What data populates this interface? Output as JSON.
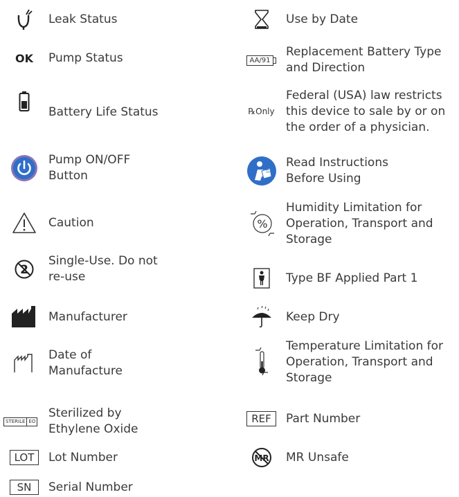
{
  "colors": {
    "accent_blue": "#2f6fc7",
    "power_ring": "#8a73b8",
    "text": "#3a3a3a"
  },
  "left": [
    {
      "icon": "leak-icon",
      "label": "Leak Status"
    },
    {
      "icon": "ok-text-icon",
      "icon_text": "OK",
      "label": "Pump Status"
    },
    {
      "icon": "battery-icon",
      "label": "Battery Life Status"
    },
    {
      "icon": "power-icon",
      "label": "Pump ON/OFF\nButton"
    },
    {
      "icon": "caution-icon",
      "label": "Caution"
    },
    {
      "icon": "single-use-icon",
      "label": "Single-Use. Do not\nre-use"
    },
    {
      "icon": "manufacturer-icon",
      "label": "Manufacturer"
    },
    {
      "icon": "date-of-manufacture-icon",
      "label": "Date of\nManufacture"
    },
    {
      "icon": "sterile-eo-icon",
      "icon_text_a": "STERILE",
      "icon_text_b": "EO",
      "label": "Sterilized by\nEthylene Oxide"
    },
    {
      "icon": "lot-icon",
      "icon_text": "LOT",
      "label": "Lot Number"
    },
    {
      "icon": "sn-icon",
      "icon_text": "SN",
      "label": "Serial Number"
    }
  ],
  "right": [
    {
      "icon": "hourglass-icon",
      "label": "Use by Date"
    },
    {
      "icon": "battery-type-icon",
      "icon_text": "AA/91",
      "label": "Replacement Battery Type\nand Direction"
    },
    {
      "icon": "rx-only-icon",
      "icon_text": "℞Only",
      "label": "Federal (USA) law restricts\nthis device to sale by or on\nthe order of a physician."
    },
    {
      "icon": "read-instructions-icon",
      "label": "Read Instructions\nBefore Using"
    },
    {
      "icon": "humidity-icon",
      "label": "Humidity Limitation for\nOperation, Transport and\nStorage"
    },
    {
      "icon": "type-bf-icon",
      "label": "Type BF Applied Part 1"
    },
    {
      "icon": "keep-dry-icon",
      "label": "Keep Dry"
    },
    {
      "icon": "temperature-icon",
      "label": "Temperature Limitation for\nOperation, Transport and\nStorage"
    },
    {
      "icon": "ref-icon",
      "icon_text": "REF",
      "label": "Part Number"
    },
    {
      "icon": "mr-unsafe-icon",
      "icon_text": "MR",
      "label": "MR Unsafe"
    }
  ]
}
